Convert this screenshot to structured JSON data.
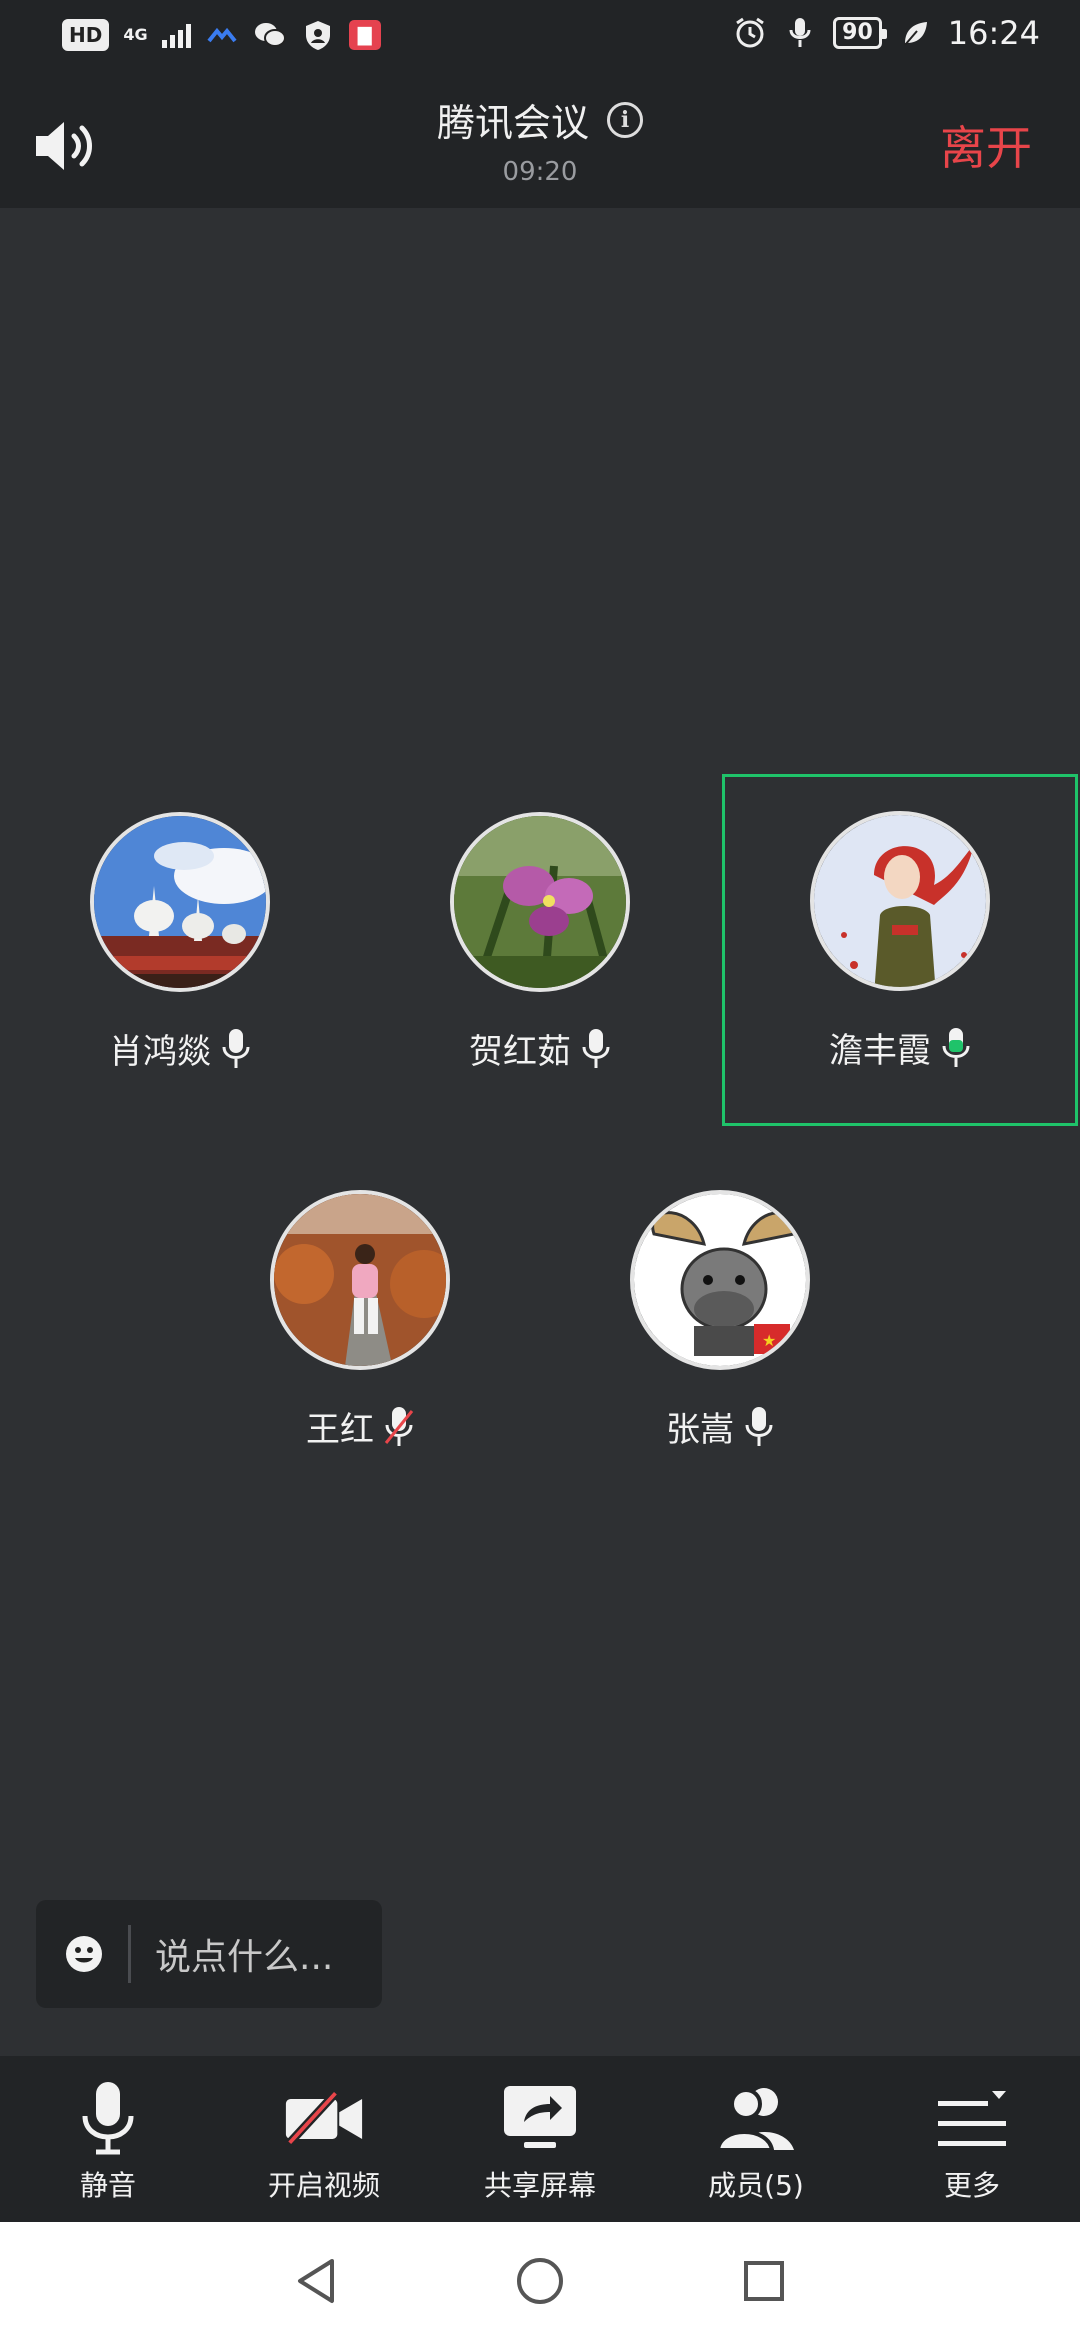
{
  "status_bar": {
    "hd": "HD",
    "network": "4G",
    "battery": "90",
    "time": "16:24"
  },
  "header": {
    "title": "腾讯会议",
    "elapsed": "09:20",
    "leave_label": "离开"
  },
  "participants": [
    {
      "name": "肖鸿燚",
      "mic": "on",
      "avatar": "pagoda"
    },
    {
      "name": "贺红茹",
      "mic": "on",
      "avatar": "flower"
    },
    {
      "name": "澹丰霞",
      "mic": "on",
      "avatar": "red-hair-girl",
      "active_speaker": true
    },
    {
      "name": "王红",
      "mic": "muted",
      "avatar": "child-on-path"
    },
    {
      "name": "张嵩",
      "mic": "on",
      "avatar": "cartoon-moose"
    }
  ],
  "chat": {
    "placeholder": "说点什么..."
  },
  "toolbar": {
    "items": [
      {
        "label": "静音",
        "icon": "microphone-icon"
      },
      {
        "label": "开启视频",
        "icon": "video-off-icon"
      },
      {
        "label": "共享屏幕",
        "icon": "share-screen-icon"
      },
      {
        "label": "成员(5)",
        "icon": "members-icon"
      },
      {
        "label": "更多",
        "icon": "more-menu-icon"
      }
    ]
  },
  "colors": {
    "background": "#2e3033",
    "bar": "#222426",
    "leave": "#e8454a",
    "active_speaker_border": "#1fc36a",
    "video_off_slash": "#e8454a"
  }
}
